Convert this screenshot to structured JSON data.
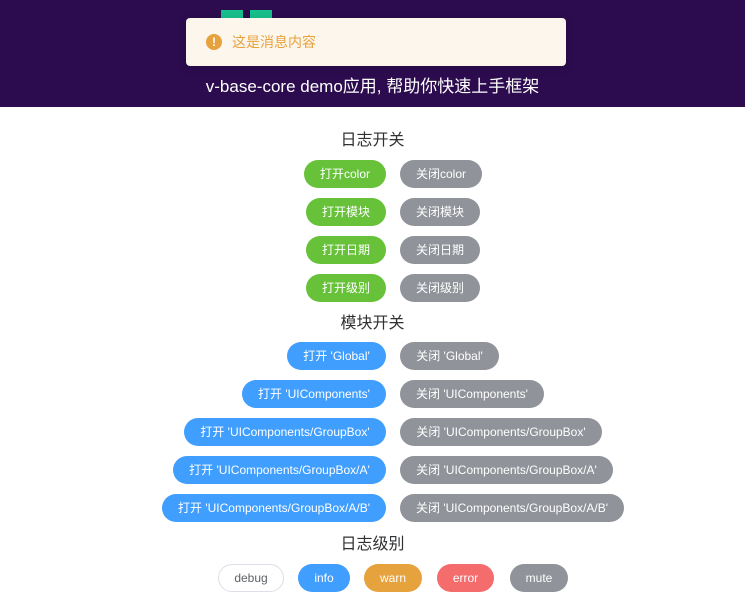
{
  "header": {
    "subtitle": "v-base-core demo应用, 帮助你快速上手框架",
    "logo_color": "#17c08c",
    "background": "#2c0c4e"
  },
  "toast": {
    "icon": "warning-icon",
    "icon_glyph": "!",
    "text": "这是消息内容"
  },
  "log_switch": {
    "title": "日志开关",
    "rows": [
      {
        "on": "打开color",
        "off": "关闭color"
      },
      {
        "on": "打开模块",
        "off": "关闭模块"
      },
      {
        "on": "打开日期",
        "off": "关闭日期"
      },
      {
        "on": "打开级别",
        "off": "关闭级别"
      }
    ]
  },
  "module_switch": {
    "title": "模块开关",
    "rows": [
      {
        "on": "打开 'Global'",
        "off": "关闭 'Global'"
      },
      {
        "on": "打开 'UIComponents'",
        "off": "关闭 'UIComponents'"
      },
      {
        "on": "打开 'UIComponents/GroupBox'",
        "off": "关闭 'UIComponents/GroupBox'"
      },
      {
        "on": "打开 'UIComponents/GroupBox/A'",
        "off": "关闭 'UIComponents/GroupBox/A'"
      },
      {
        "on": "打开 'UIComponents/GroupBox/A/B'",
        "off": "关闭 'UIComponents/GroupBox/A/B'"
      }
    ]
  },
  "log_level": {
    "title": "日志级别",
    "levels": [
      "debug",
      "info",
      "warn",
      "error",
      "mute"
    ]
  },
  "colors": {
    "success": "#67c23a",
    "info": "#909399",
    "primary": "#409eff",
    "warning": "#e6a23c",
    "danger": "#f56c6c"
  }
}
